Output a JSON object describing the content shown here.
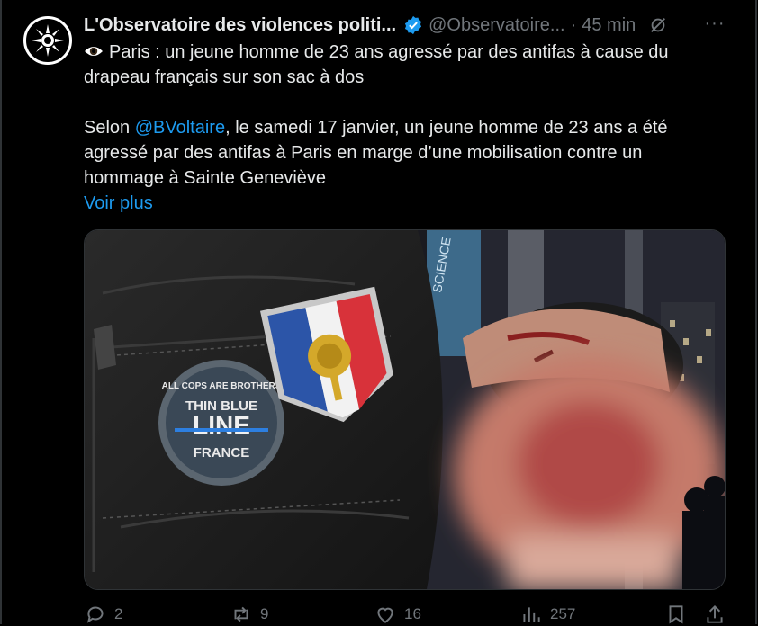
{
  "tweet": {
    "author_name": "L'Observatoire des violences politi...",
    "handle": "@Observatoire...",
    "separator": "·",
    "time": "45 min",
    "more_label": "···",
    "text_line1": "Paris : un jeune homme de 23 ans agressé par des antifas à cause du",
    "text_line2": "drapeau français sur son sac à dos",
    "text_p2_prefix": "Selon ",
    "mention": "@BVoltaire",
    "text_p2_rest1": ", le samedi 17 janvier, un jeune homme de 23 ans a été",
    "text_p2_line2": "agressé par des antifas à Paris en marge d’une mobilisation contre un",
    "text_p2_line3": "hommage à Sainte Geneviève",
    "voir_plus": "Voir plus",
    "emoji_icon": "eye-icon"
  },
  "media": {
    "patch_top": "ALL COPS ARE BROTHERS",
    "patch_thin": "THIN BLUE",
    "patch_line": "LINE",
    "patch_france": "FRANCE",
    "banner_text": "SCIENCE"
  },
  "actions": {
    "replies": "2",
    "reposts": "9",
    "likes": "16",
    "views": "257"
  },
  "colors": {
    "accent": "#1d9bf0",
    "muted": "#71767b",
    "text": "#e7e9ea",
    "background": "#000000"
  }
}
